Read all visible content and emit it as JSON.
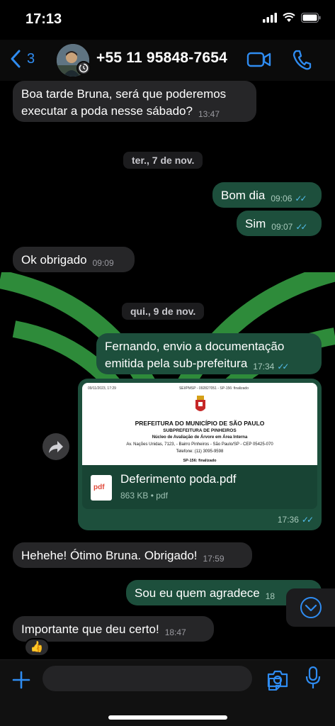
{
  "status_bar": {
    "time": "17:13"
  },
  "header": {
    "back_count": "3",
    "contact_name": "+55 11 95848-7654"
  },
  "messages": [
    {
      "text_line1": "Boa tarde Bruna, será que poderemos",
      "text_line2": "executar a poda nesse sábado?",
      "time": "13:47"
    },
    {
      "date_separator": "ter., 7 de nov."
    },
    {
      "text": "Bom dia",
      "time": "09:06"
    },
    {
      "text": "Sim",
      "time": "09:07"
    },
    {
      "text": "Ok obrigado",
      "time": "09:09"
    },
    {
      "date_separator": "qui., 9 de nov."
    },
    {
      "text_line1": "Fernando, envio a documentação",
      "text_line2": "emitida pela sub-prefeitura",
      "time": "17:34"
    },
    {
      "document": {
        "preview": {
          "meta_left": "09/11/2023, 17:29",
          "meta_center": "SEI/PMSP - 092827051 - SP-156: finalizado",
          "title": "PREFEITURA DO MUNICÍPIO DE SÃO PAULO",
          "subtitle": "SUBPREFEITURA DE PINHEIROS",
          "department": "Núcleo de Avaliação de Árvore em Área Interna",
          "address": "Av. Nações Unidas, 7123, - Bairro Pinheiros - São Paulo/SP - CEP 05425-070",
          "phone": "Telefone: (11) 3095-9598",
          "status": "SP-156: finalizado"
        },
        "icon_label": "pdf",
        "file_name": "Deferimento poda.pdf",
        "file_info": "863 KB • pdf",
        "time": "17:36"
      }
    },
    {
      "text": "Hehehe! Ótimo Bruna. Obrigado!",
      "time": "17:59"
    },
    {
      "text": "Sou eu quem agradece",
      "time": "18"
    },
    {
      "text": "Importante que deu certo!",
      "time": "18:47",
      "reaction": "👍"
    }
  ],
  "colors": {
    "accent": "#2f8cf1",
    "bubble_out": "#1d4f3c",
    "bubble_in": "#262628",
    "read_ticks": "#53bdeb",
    "wallpaper_green": "#2e8b3a"
  },
  "icons": [
    "back-chevron-icon",
    "video-call-icon",
    "phone-call-icon",
    "forward-icon",
    "pdf-icon",
    "chevron-down-icon",
    "plus-icon",
    "sticker-icon",
    "camera-icon",
    "microphone-icon"
  ]
}
